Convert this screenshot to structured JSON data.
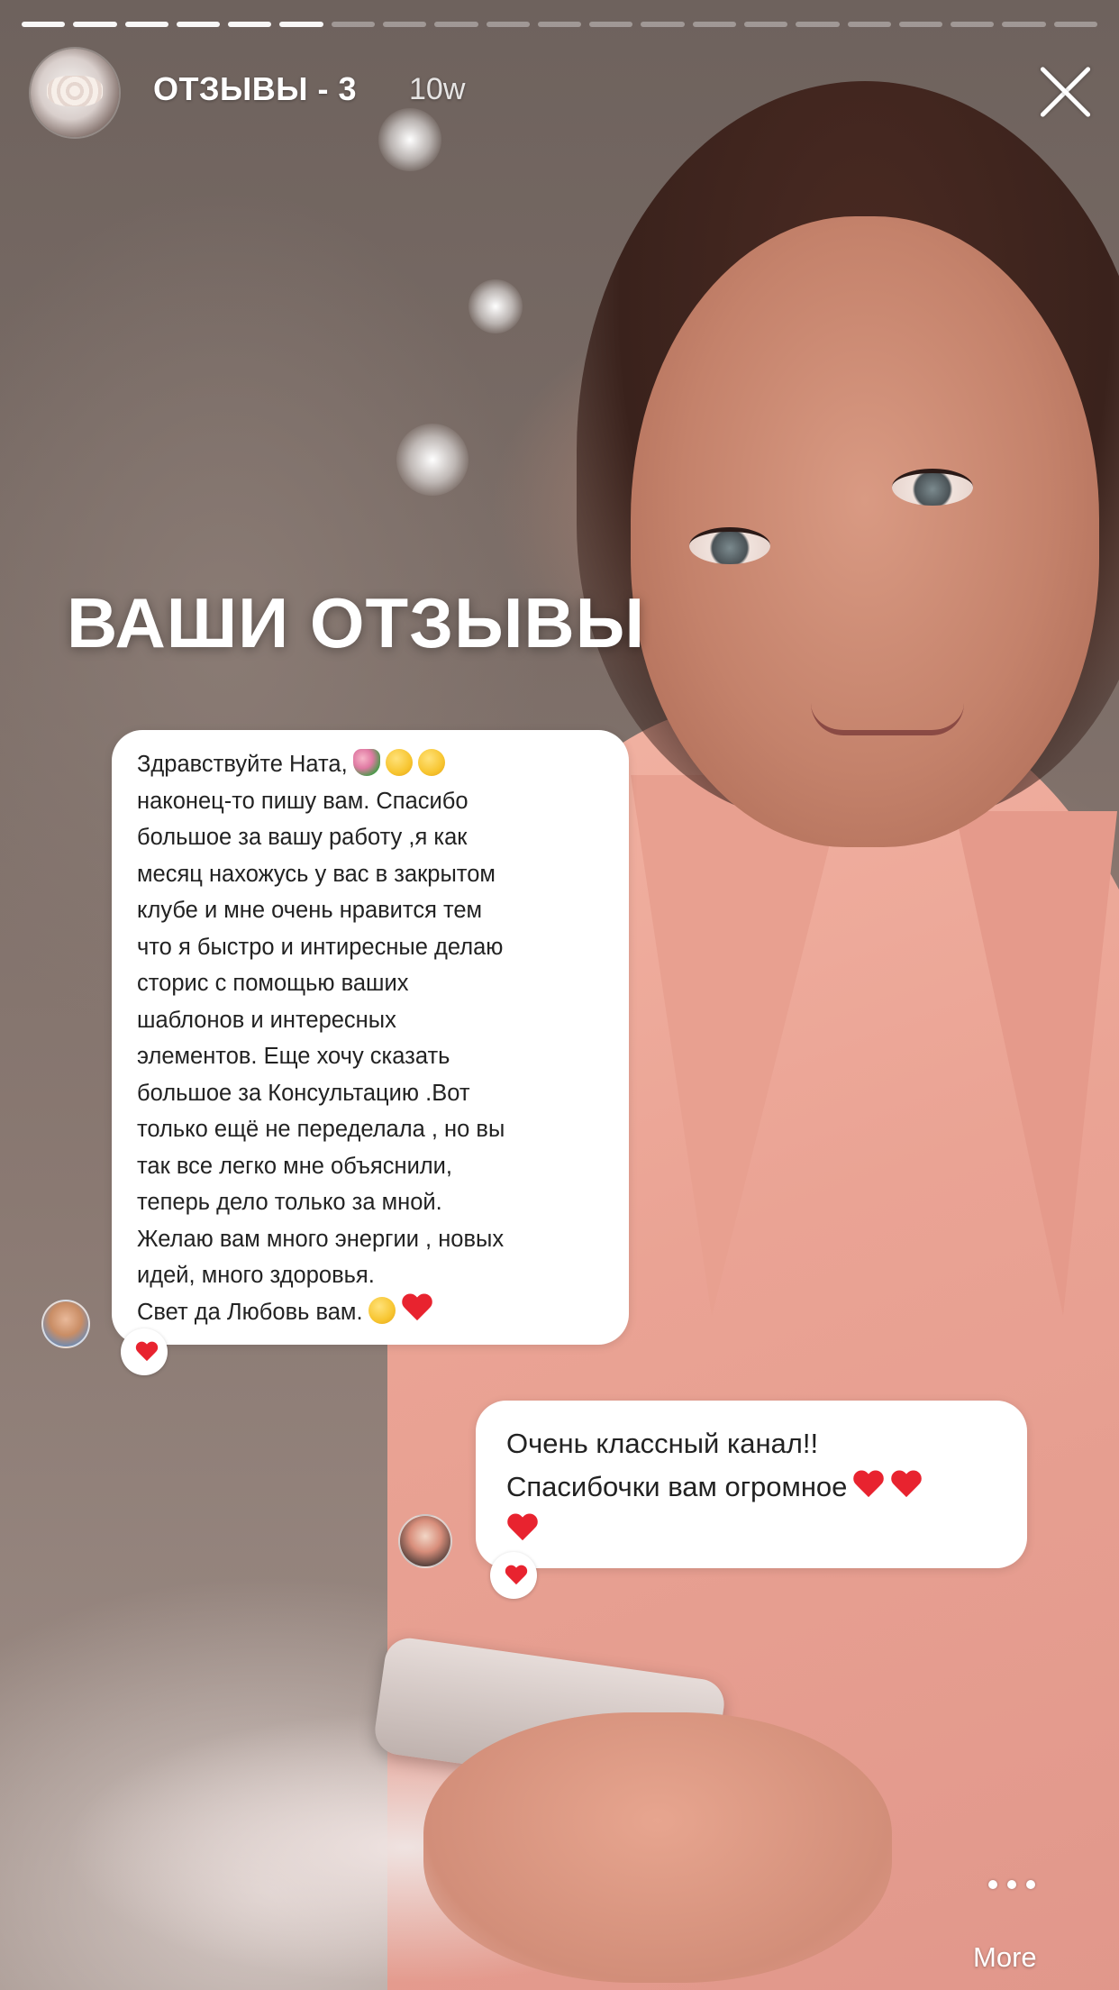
{
  "story": {
    "progress": {
      "total_segments": 21,
      "completed_segments": 5,
      "current_segment": 6
    },
    "header": {
      "title": "ОТЗЫВЫ - 3",
      "time": "10w",
      "close_icon": "close-icon"
    },
    "headline": "ВАШИ ОТЗЫВЫ",
    "reviews": [
      {
        "lines": [
          "Здравствуйте Ната,",
          "наконец-то пишу вам. Спасибо",
          "большое за вашу работу ,я как",
          "месяц нахожусь у вас в закрытом",
          "клубе и мне очень нравится  тем",
          "что я быстро и интиресные   делаю",
          "сторис с помощью ваших",
          "шаблонов и интересных",
          "элементов. Еще хочу сказать",
          "большое за Консультацию .Вот",
          "только ещё не переделала ,  но вы",
          "так все легко мне объяснили,",
          "теперь дело только за мной.",
          "Желаю вам много энергии , новых",
          "идей, много здоровья.",
          "Свет да Любовь вам."
        ],
        "reaction": "heart"
      },
      {
        "lines": [
          "Очень классный канал!!",
          "Спасибочки вам огромное"
        ],
        "reaction": "heart"
      }
    ],
    "more_label": "More",
    "colors": {
      "heart": "#e8232f",
      "bubble": "#ffffff",
      "text": "#222222"
    }
  }
}
